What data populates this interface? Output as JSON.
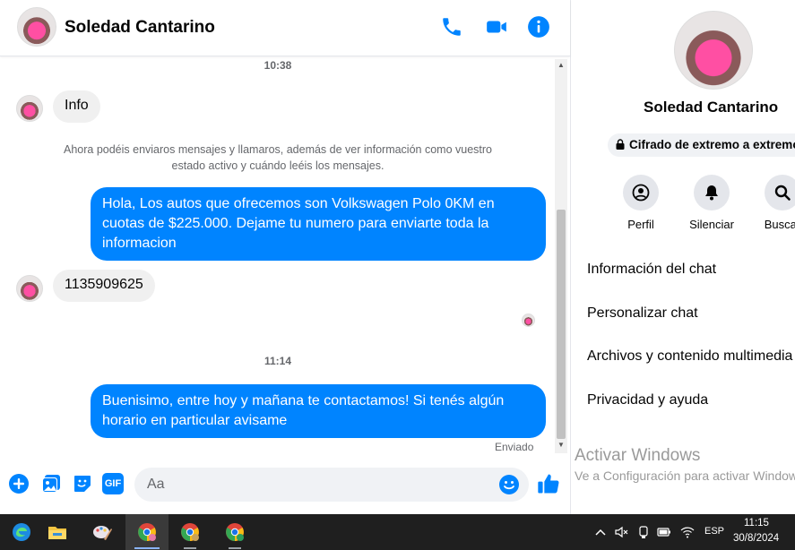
{
  "contact": {
    "name": "Soledad Cantarino"
  },
  "messages": {
    "timestamp_1": "10:38",
    "incoming_1": "Info",
    "notice": "Ahora podéis enviaros mensajes y llamaros, además de ver información como vuestro estado activo y cuándo leéis los mensajes.",
    "outgoing_1": "Hola, Los autos que ofrecemos son Volkswagen Polo 0KM en cuotas de $225.000. Dejame tu numero para enviarte toda la informacion",
    "incoming_2": "1135909625",
    "timestamp_2": "11:14",
    "outgoing_2": "Buenisimo, entre hoy y mañana te contactamos! Si tenés algún horario en particular avisame",
    "status": "Enviado"
  },
  "composer": {
    "placeholder": "Aa",
    "gif_label": "GIF"
  },
  "panel": {
    "name": "Soledad Cantarino",
    "encryption": "Cifrado de extremo a extremo",
    "actions": [
      {
        "label": "Perfil",
        "icon": "profile-icon"
      },
      {
        "label": "Silenciar",
        "icon": "bell-icon"
      },
      {
        "label": "Buscar",
        "icon": "search-icon"
      }
    ],
    "menu": [
      "Información del chat",
      "Personalizar chat",
      "Archivos y contenido multimedia",
      "Privacidad y ayuda"
    ]
  },
  "watermark": {
    "title": "Activar Windows",
    "subtitle": "Ve a Configuración para activar Windows."
  },
  "taskbar": {
    "lang": "ESP",
    "time": "11:15",
    "date": "30/8/2024"
  },
  "colors": {
    "accent": "#0084ff",
    "bubble_in": "#f0f0f0",
    "taskbar": "#1f1f1f"
  }
}
